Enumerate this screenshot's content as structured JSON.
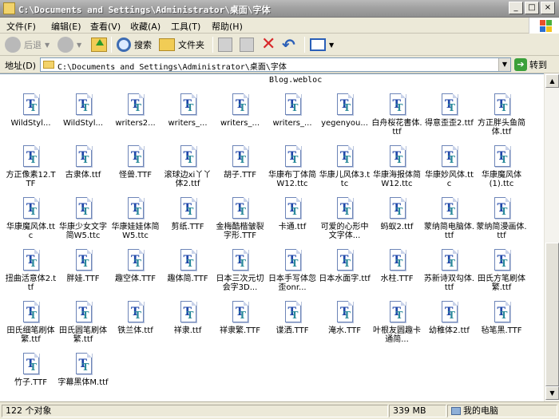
{
  "window": {
    "title": "C:\\Documents and Settings\\Administrator\\桌面\\字体",
    "controls": {
      "minimize": "_",
      "maximize": "□",
      "close": "×"
    }
  },
  "menu": [
    "文件(F)",
    "编辑(E)",
    "查看(V)",
    "收藏(A)",
    "工具(T)",
    "帮助(H)"
  ],
  "toolbar": {
    "back_label": "后退",
    "search_label": "搜索",
    "folders_label": "文件夹"
  },
  "address": {
    "label": "地址(D)",
    "path": "C:\\Documents and Settings\\Administrator\\桌面\\字体",
    "go_label": "转到"
  },
  "content": {
    "top_file": "Blog.webloc",
    "files": [
      "WildStyl...",
      "WildStyl...",
      "writers2...",
      "writers_...",
      "writers_...",
      "writers_...",
      "yegenyou...",
      "白舟桜花書体.ttf",
      "得意歪歪2.ttf",
      "方正胖头鱼简体.ttf",
      "方正像素12.TTF",
      "古隶体.ttf",
      "怪兽.TTF",
      "滚球边xi丫丫体2.ttf",
      "胡子.TTF",
      "华康布丁体简W12.ttc",
      "华康儿风体3.ttc",
      "华康海报体简W12.ttc",
      "华康妙风体.ttc",
      "华康魔风体(1).ttc",
      "华康魔风体.ttc",
      "华康少女文字简W5.ttc",
      "华康娃娃体简W5.ttc",
      "剪纸.TTF",
      "金梅酷楷皱裂字形.TTF",
      "卡通.ttf",
      "可爱的心形中文字体...",
      "蚂蚁2.ttf",
      "蒙纳简电脑体.ttf",
      "蒙纳简漫画体.ttf",
      "扭曲活意体2.ttf",
      "胖娃.TTF",
      "趣空体.TTF",
      "趣体简.TTF",
      "日本三次元切会字3D...",
      "日本手写体忽歪onr...",
      "日本水面字.ttf",
      "水柱.TTF",
      "苏新诗双勾体.ttf",
      "田氏方笔刷体繁.ttf",
      "田氏细笔刷体繁.ttf",
      "田氏圆笔刷体繁.ttf",
      "铁兰体.ttf",
      "祥隶.ttf",
      "祥隶繁.TTF",
      "谍洒.TTF",
      "淹水.TTF",
      "叶根友圆趣卡通简...",
      "幼稚体2.ttf",
      "毡笔黑.TTF",
      "竹子.TTF",
      "字幕黑体M.ttf"
    ]
  },
  "status": {
    "objects": "122 个对象",
    "size": "339 MB",
    "location": "我的电脑"
  }
}
